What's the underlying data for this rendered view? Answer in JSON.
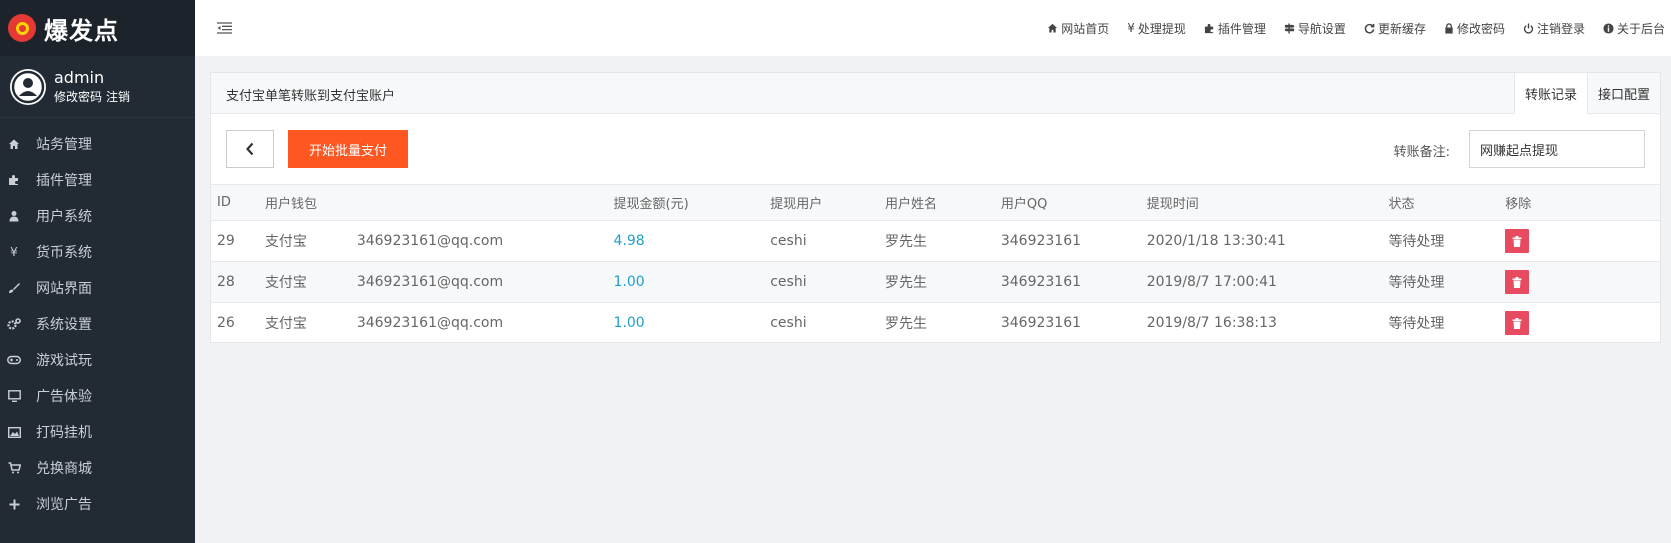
{
  "brand": {
    "name": "爆发点"
  },
  "user": {
    "name": "admin",
    "change_password": "修改密码",
    "logout": "注销"
  },
  "sidebar": {
    "items": [
      {
        "label": "站务管理",
        "icon": "home-icon"
      },
      {
        "label": "插件管理",
        "icon": "puzzle-icon"
      },
      {
        "label": "用户系统",
        "icon": "user-icon"
      },
      {
        "label": "货币系统",
        "icon": "yen-icon"
      },
      {
        "label": "网站界面",
        "icon": "brush-icon"
      },
      {
        "label": "系统设置",
        "icon": "gears-icon"
      },
      {
        "label": "游戏试玩",
        "icon": "gamepad-icon"
      },
      {
        "label": "广告体验",
        "icon": "monitor-icon"
      },
      {
        "label": "打码挂机",
        "icon": "image-icon"
      },
      {
        "label": "兑换商城",
        "icon": "cart-icon"
      },
      {
        "label": "浏览广告",
        "icon": "plus-icon"
      }
    ]
  },
  "topnav": {
    "home": "网站首页",
    "withdraw": "处理提现",
    "plugins": "插件管理",
    "navigation": "导航设置",
    "cache": "更新缓存",
    "password": "修改密码",
    "logout": "注销登录",
    "about": "关于后台"
  },
  "panel": {
    "title": "支付宝单笔转账到支付宝账户",
    "tabs": [
      "转账记录",
      "接口配置"
    ],
    "batch_pay_label": "开始批量支付",
    "remark_label": "转账备注:",
    "remark_value": "网赚起点提现"
  },
  "table": {
    "headers": [
      "ID",
      "用户钱包",
      "",
      "提现金额(元)",
      "提现用户",
      "用户姓名",
      "用户QQ",
      "提现时间",
      "状态",
      "移除"
    ],
    "rows": [
      {
        "id": "29",
        "wallet": "支付宝",
        "account": "346923161@qq.com",
        "amount": "4.98",
        "user": "ceshi",
        "name": "罗先生",
        "qq": "346923161",
        "time": "2020/1/18 13:30:41",
        "status": "等待处理"
      },
      {
        "id": "28",
        "wallet": "支付宝",
        "account": "346923161@qq.com",
        "amount": "1.00",
        "user": "ceshi",
        "name": "罗先生",
        "qq": "346923161",
        "time": "2019/8/7 17:00:41",
        "status": "等待处理"
      },
      {
        "id": "26",
        "wallet": "支付宝",
        "account": "346923161@qq.com",
        "amount": "1.00",
        "user": "ceshi",
        "name": "罗先生",
        "qq": "346923161",
        "time": "2019/8/7 16:38:13",
        "status": "等待处理"
      }
    ]
  },
  "colors": {
    "sidebar_bg": "#222b34",
    "accent_button": "#ff5722",
    "amount_text": "#1e9fc9",
    "delete_button": "#e84a5f"
  }
}
